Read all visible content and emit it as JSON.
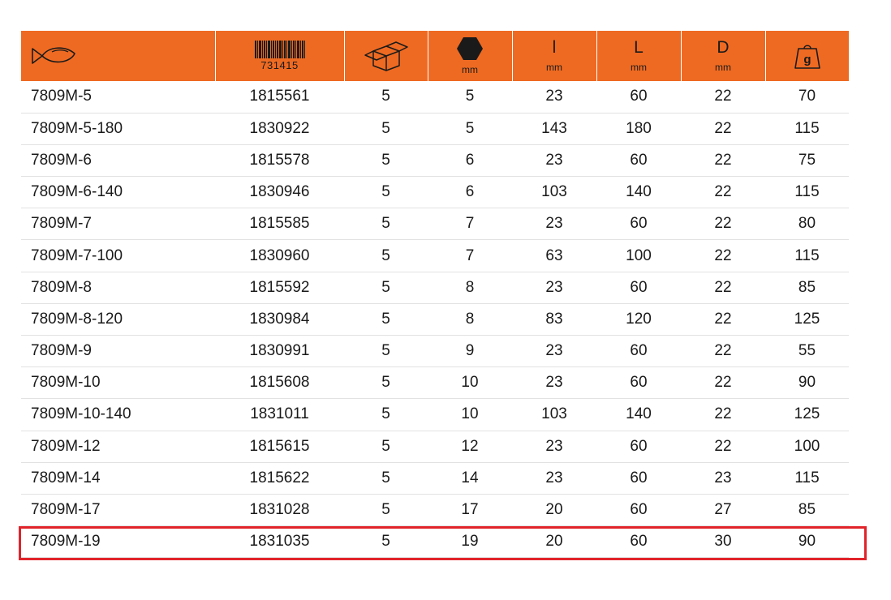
{
  "header": {
    "barcode_code": "731415",
    "units": {
      "hex": "mm",
      "l": "mm",
      "L": "mm",
      "D": "mm"
    },
    "symbols": {
      "l": "l",
      "L": "L",
      "D": "D",
      "weight": "g"
    },
    "icons": [
      "fish-icon",
      "barcode-icon",
      "box-icon",
      "hexagon-icon",
      "weight-icon"
    ]
  },
  "rows": [
    [
      "7809M-5",
      "1815561",
      "5",
      "5",
      "23",
      "60",
      "22",
      "70"
    ],
    [
      "7809M-5-180",
      "1830922",
      "5",
      "5",
      "143",
      "180",
      "22",
      "115"
    ],
    [
      "7809M-6",
      "1815578",
      "5",
      "6",
      "23",
      "60",
      "22",
      "75"
    ],
    [
      "7809M-6-140",
      "1830946",
      "5",
      "6",
      "103",
      "140",
      "22",
      "115"
    ],
    [
      "7809M-7",
      "1815585",
      "5",
      "7",
      "23",
      "60",
      "22",
      "80"
    ],
    [
      "7809M-7-100",
      "1830960",
      "5",
      "7",
      "63",
      "100",
      "22",
      "115"
    ],
    [
      "7809M-8",
      "1815592",
      "5",
      "8",
      "23",
      "60",
      "22",
      "85"
    ],
    [
      "7809M-8-120",
      "1830984",
      "5",
      "8",
      "83",
      "120",
      "22",
      "125"
    ],
    [
      "7809M-9",
      "1830991",
      "5",
      "9",
      "23",
      "60",
      "22",
      "55"
    ],
    [
      "7809M-10",
      "1815608",
      "5",
      "10",
      "23",
      "60",
      "22",
      "90"
    ],
    [
      "7809M-10-140",
      "1831011",
      "5",
      "10",
      "103",
      "140",
      "22",
      "125"
    ],
    [
      "7809M-12",
      "1815615",
      "5",
      "12",
      "23",
      "60",
      "22",
      "100"
    ],
    [
      "7809M-14",
      "1815622",
      "5",
      "14",
      "23",
      "60",
      "23",
      "115"
    ],
    [
      "7809M-17",
      "1831028",
      "5",
      "17",
      "20",
      "60",
      "27",
      "85"
    ],
    [
      "7809M-19",
      "1831035",
      "5",
      "19",
      "20",
      "60",
      "30",
      "90"
    ]
  ],
  "highlighted_row": 14,
  "colors": {
    "header_bg": "#ee6a22",
    "highlight": "#e1232a",
    "row_divider": "#e2e2e2"
  }
}
